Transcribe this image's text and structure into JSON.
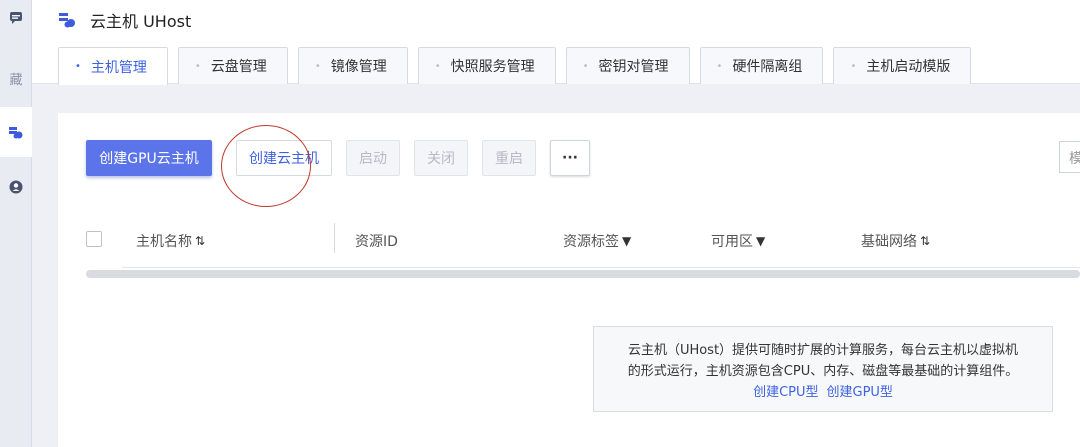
{
  "rail": {
    "partial_label": "藏",
    "icons": [
      "chat-icon",
      "cloud-host-icon",
      "user-icon"
    ]
  },
  "header": {
    "title": "云主机 UHost",
    "tabs": [
      {
        "label": "主机管理",
        "active": true
      },
      {
        "label": "云盘管理",
        "active": false
      },
      {
        "label": "镜像管理",
        "active": false
      },
      {
        "label": "快照服务管理",
        "active": false
      },
      {
        "label": "密钥对管理",
        "active": false
      },
      {
        "label": "硬件隔离组",
        "active": false
      },
      {
        "label": "主机启动模版",
        "active": false
      }
    ]
  },
  "toolbar": {
    "create_gpu": "创建GPU云主机",
    "create_host": "创建云主机",
    "start": "启动",
    "stop": "关闭",
    "restart": "重启",
    "more": "···",
    "search_edge": "模"
  },
  "table": {
    "columns": [
      "主机名称",
      "资源ID",
      "资源标签",
      "可用区",
      "基础网络"
    ]
  },
  "empty_note": {
    "line1": "云主机（UHost）提供可随时扩展的计算服务，每台云主机以虚拟机",
    "line2": "的形式运行，主机资源包含CPU、内存、磁盘等最基础的计算组件。",
    "link_cpu": "创建CPU型",
    "link_gpu": "创建GPU型"
  },
  "colors": {
    "primary": "#5b74ea",
    "link": "#3e62e0",
    "annotation_circle": "#c0392b"
  }
}
